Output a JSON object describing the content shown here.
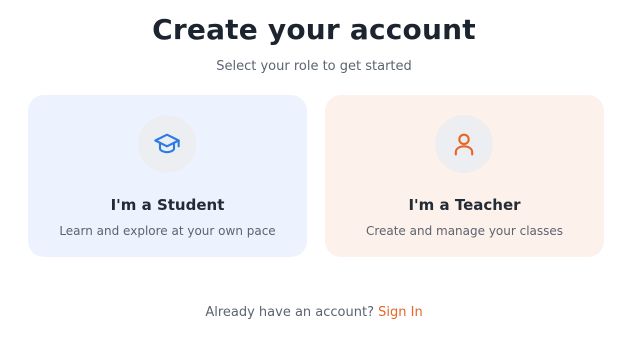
{
  "header": {
    "title": "Create your account",
    "subtitle": "Select your role to get started"
  },
  "roles": [
    {
      "title": "I'm a Student",
      "description": "Learn and explore at your own pace",
      "icon": "graduation-cap-icon",
      "background": "#ecf3fe",
      "icon_color": "#2c7be5"
    },
    {
      "title": "I'm a Teacher",
      "description": "Create and manage your classes",
      "icon": "user-icon",
      "background": "#fdf1eb",
      "icon_color": "#e4672a"
    }
  ],
  "footer": {
    "prompt": "Already have an account?",
    "link_label": "Sign In",
    "link_color": "#e4672a"
  }
}
